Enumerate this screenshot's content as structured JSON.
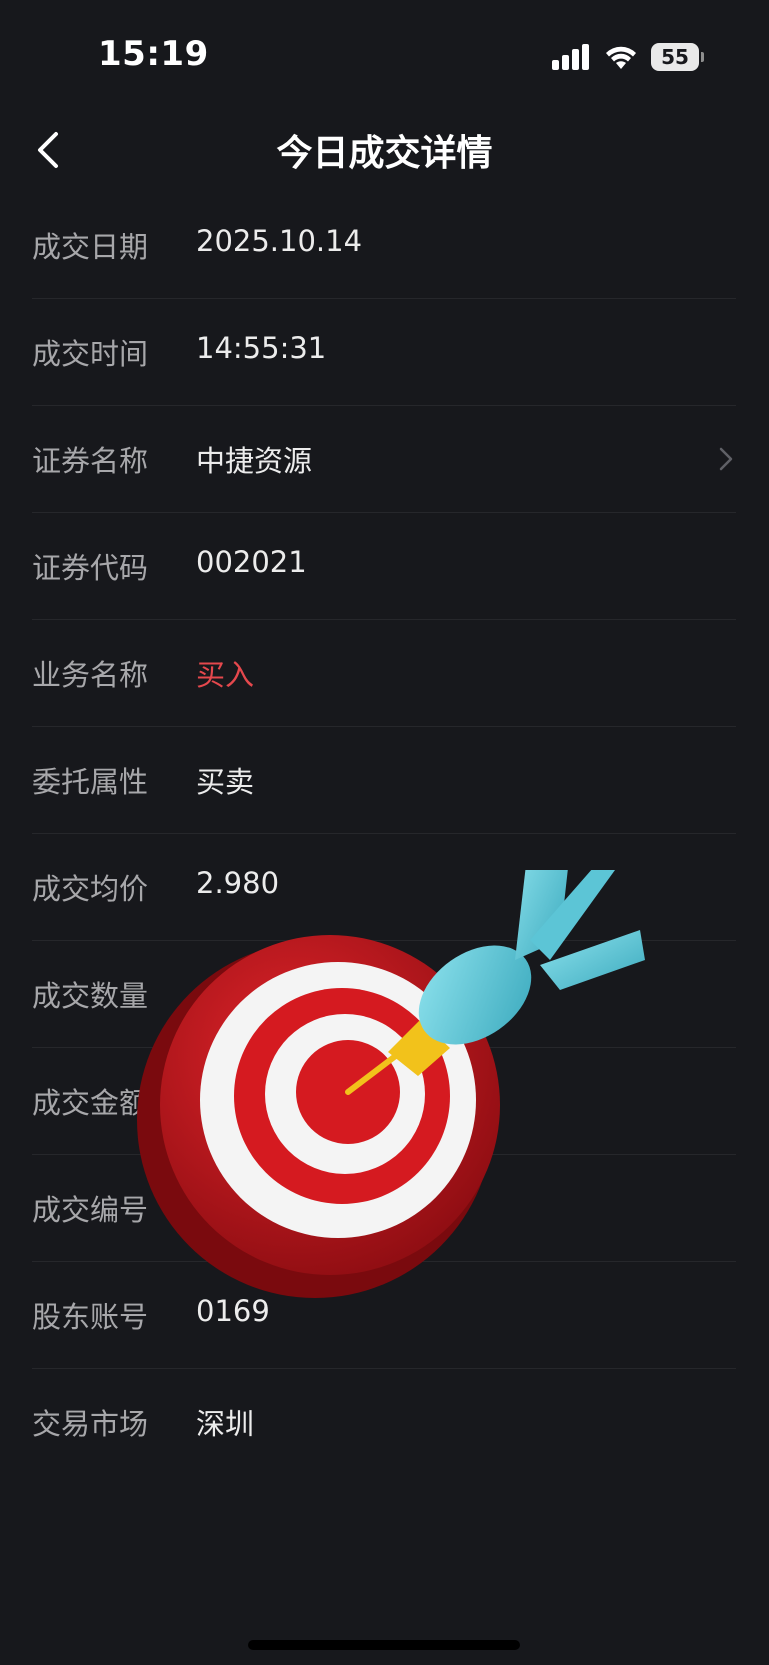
{
  "status_bar": {
    "time": "15:19",
    "battery": "55"
  },
  "nav": {
    "title": "今日成交详情",
    "back_icon": "chevron-left-icon"
  },
  "details": [
    {
      "label": "成交日期",
      "value": "2025.10.14"
    },
    {
      "label": "成交时间",
      "value": "14:55:31"
    },
    {
      "label": "证券名称",
      "value": "中捷资源",
      "has_chevron": true
    },
    {
      "label": "证券代码",
      "value": "002021"
    },
    {
      "label": "业务名称",
      "value": "买入",
      "color": "#e5484d"
    },
    {
      "label": "委托属性",
      "value": "买卖"
    },
    {
      "label": "成交均价",
      "value": "2.980"
    },
    {
      "label": "成交数量",
      "value": ""
    },
    {
      "label": "成交金额",
      "value": ""
    },
    {
      "label": "成交编号",
      "value": ""
    },
    {
      "label": "股东账号",
      "value": "0169"
    },
    {
      "label": "交易市场",
      "value": "深圳"
    }
  ],
  "overlay": {
    "icon": "dart-target-icon"
  },
  "colors": {
    "background": "#17181c",
    "buy_red": "#e5484d",
    "label_gray": "#a7a7aa"
  }
}
